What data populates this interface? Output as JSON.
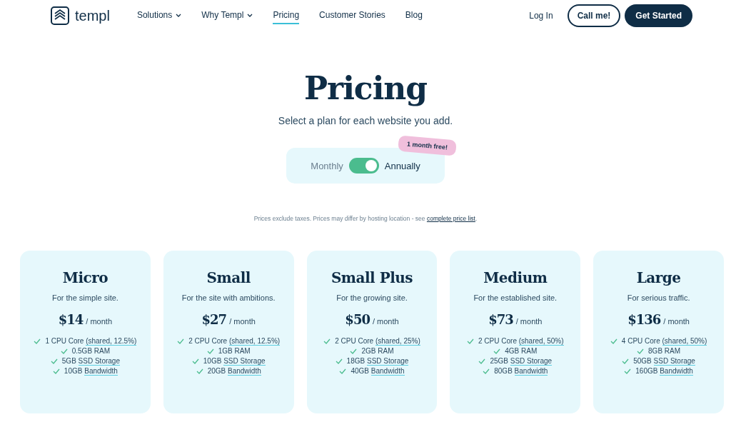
{
  "nav": {
    "brand": "templ",
    "items": [
      {
        "label": "Solutions",
        "dropdown": true,
        "selected": false
      },
      {
        "label": "Why Templ",
        "dropdown": true,
        "selected": false
      },
      {
        "label": "Pricing",
        "dropdown": false,
        "selected": true
      },
      {
        "label": "Customer Stories",
        "dropdown": false,
        "selected": false
      },
      {
        "label": "Blog",
        "dropdown": false,
        "selected": false
      }
    ],
    "login": "Log In",
    "call": "Call me!",
    "cta": "Get Started"
  },
  "header": {
    "title": "Pricing",
    "subtitle": "Select a plan for each website you add."
  },
  "billing": {
    "monthly": "Monthly",
    "annually": "Annually",
    "on": true,
    "badge": "1 month free!"
  },
  "note": {
    "text": "Prices exclude taxes. Prices may differ by hosting location - see ",
    "link": "complete price list",
    "end": "."
  },
  "plans": [
    {
      "name": "Micro",
      "tagline": "For the simple site.",
      "price": "$14",
      "period": "/ month",
      "features": [
        {
          "value": "1 CPU Core ",
          "term": "(shared, 12.5%)"
        },
        {
          "value": "0.5GB RAM"
        },
        {
          "value": "5GB ",
          "term": "SSD Storage"
        },
        {
          "value": "10GB ",
          "term": "Bandwidth"
        }
      ]
    },
    {
      "name": "Small",
      "tagline": "For the site with ambitions.",
      "price": "$27",
      "period": "/ month",
      "features": [
        {
          "value": "2 CPU Core ",
          "term": "(shared, 12.5%)"
        },
        {
          "value": "1GB RAM"
        },
        {
          "value": "10GB ",
          "term": "SSD Storage"
        },
        {
          "value": "20GB ",
          "term": "Bandwidth"
        }
      ]
    },
    {
      "name": "Small Plus",
      "tagline": "For the growing site.",
      "price": "$50",
      "period": "/ month",
      "features": [
        {
          "value": "2 CPU Core ",
          "term": "(shared, 25%)"
        },
        {
          "value": "2GB RAM"
        },
        {
          "value": "18GB ",
          "term": "SSD Storage"
        },
        {
          "value": "40GB ",
          "term": "Bandwidth"
        }
      ]
    },
    {
      "name": "Medium",
      "tagline": "For the established site.",
      "price": "$73",
      "period": "/ month",
      "features": [
        {
          "value": "2 CPU Core ",
          "term": "(shared, 50%)"
        },
        {
          "value": "4GB RAM"
        },
        {
          "value": "25GB ",
          "term": "SSD Storage"
        },
        {
          "value": "80GB ",
          "term": "Bandwidth"
        }
      ]
    },
    {
      "name": "Large",
      "tagline": "For serious traffic.",
      "price": "$136",
      "period": "/ month",
      "features": [
        {
          "value": "4 CPU Core ",
          "term": "(shared, 50%)"
        },
        {
          "value": "8GB RAM"
        },
        {
          "value": "50GB ",
          "term": "SSD Storage"
        },
        {
          "value": "160GB ",
          "term": "Bandwidth"
        }
      ]
    }
  ]
}
